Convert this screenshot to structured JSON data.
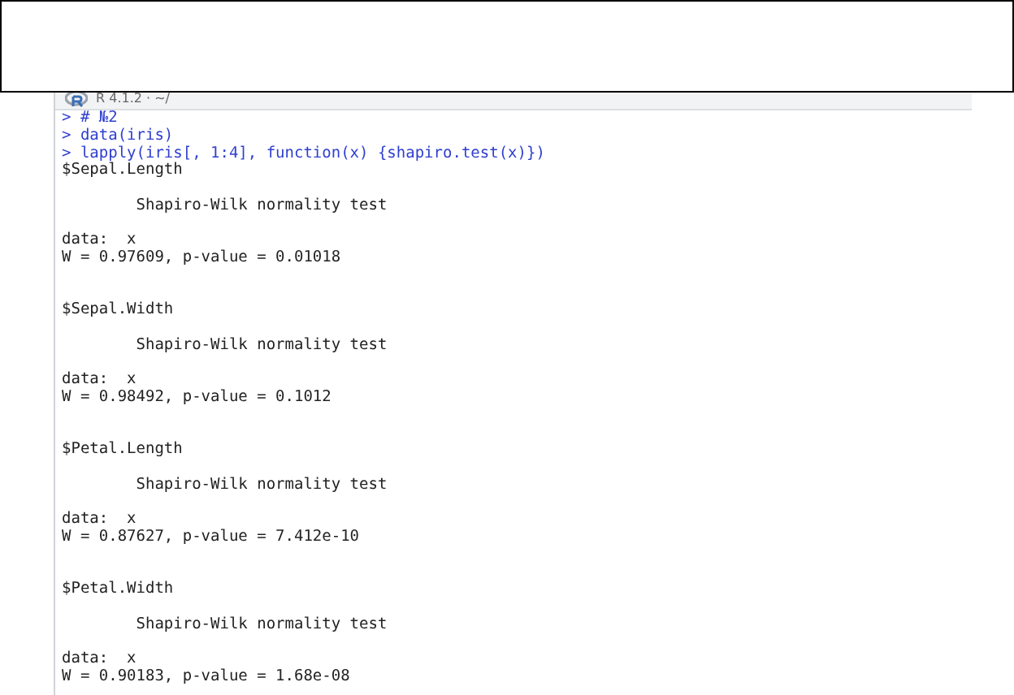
{
  "console": {
    "header": {
      "title": "R 4.1.2 · ~/"
    },
    "lines": [
      {
        "kind": "input",
        "text": "> # №2"
      },
      {
        "kind": "input",
        "text": "> data(iris)"
      },
      {
        "kind": "input",
        "text": "> lapply(iris[, 1:4], function(x) {shapiro.test(x)})"
      },
      {
        "kind": "output",
        "text": "$Sepal.Length"
      },
      {
        "kind": "spacer"
      },
      {
        "kind": "output",
        "text": "        Shapiro-Wilk normality test"
      },
      {
        "kind": "spacer"
      },
      {
        "kind": "output",
        "text": "data:  x"
      },
      {
        "kind": "output",
        "text": "W = 0.97609, p-value = 0.01018"
      },
      {
        "kind": "spacer"
      },
      {
        "kind": "spacer"
      },
      {
        "kind": "output",
        "text": "$Sepal.Width"
      },
      {
        "kind": "spacer"
      },
      {
        "kind": "output",
        "text": "        Shapiro-Wilk normality test"
      },
      {
        "kind": "spacer"
      },
      {
        "kind": "output",
        "text": "data:  x"
      },
      {
        "kind": "output",
        "text": "W = 0.98492, p-value = 0.1012"
      },
      {
        "kind": "spacer"
      },
      {
        "kind": "spacer"
      },
      {
        "kind": "output",
        "text": "$Petal.Length"
      },
      {
        "kind": "spacer"
      },
      {
        "kind": "output",
        "text": "        Shapiro-Wilk normality test"
      },
      {
        "kind": "spacer"
      },
      {
        "kind": "output",
        "text": "data:  x"
      },
      {
        "kind": "output",
        "text": "W = 0.87627, p-value = 7.412e-10"
      },
      {
        "kind": "spacer"
      },
      {
        "kind": "spacer"
      },
      {
        "kind": "output",
        "text": "$Petal.Width"
      },
      {
        "kind": "spacer"
      },
      {
        "kind": "output",
        "text": "        Shapiro-Wilk normality test"
      },
      {
        "kind": "spacer"
      },
      {
        "kind": "output",
        "text": "data:  x"
      },
      {
        "kind": "output",
        "text": "W = 0.90183, p-value = 1.68e-08"
      }
    ]
  }
}
